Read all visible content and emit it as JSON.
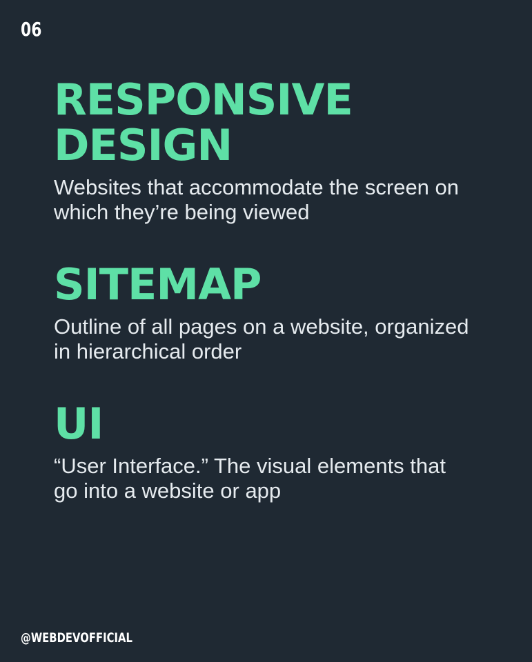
{
  "slide_number": "06",
  "terms": [
    {
      "title_lines": [
        "RESPONSIVE",
        "DESIGN"
      ],
      "description_lines": [
        "Websites that accommodate the screen on",
        "which they’re being viewed"
      ]
    },
    {
      "title_lines": [
        "SITEMAP"
      ],
      "description_lines": [
        "Outline of all pages on a website, organized",
        "in hierarchical order"
      ]
    },
    {
      "title_lines": [
        "UI"
      ],
      "description_lines": [
        "“User Interface.” The visual elements that",
        "go into a website or app"
      ]
    }
  ],
  "footer": {
    "handle": "@WEBDEVOFFICIAL"
  },
  "colors": {
    "background": "#1f2933",
    "accent": "#5ee0a6",
    "text": "#e6ebef"
  }
}
